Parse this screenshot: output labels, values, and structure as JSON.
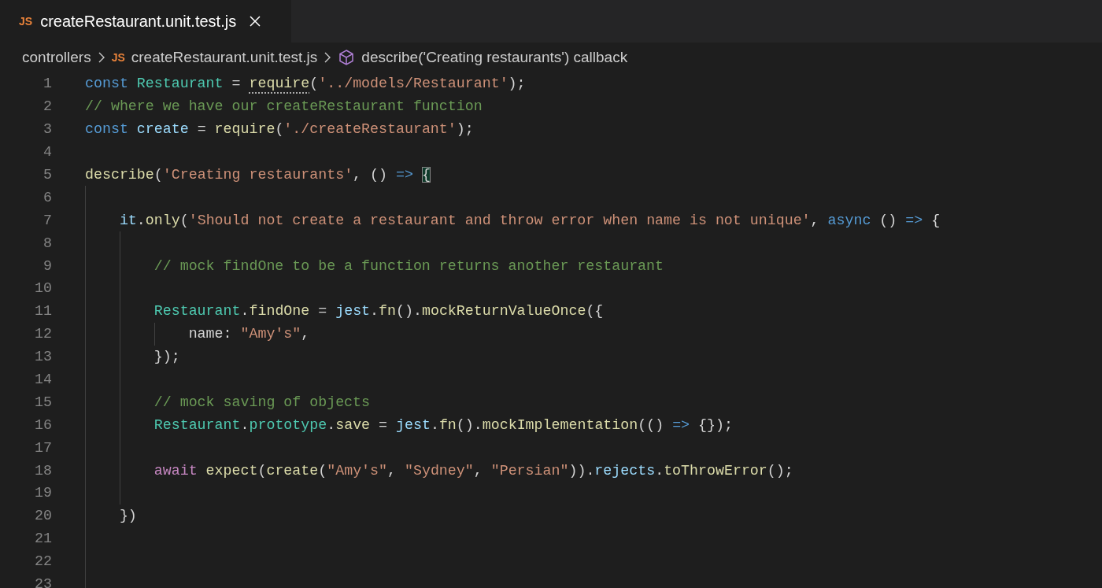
{
  "tabs": [
    {
      "label": "createRestaurant.unit.test.js",
      "badge": "JS",
      "selected": true
    }
  ],
  "breadcrumbs": [
    {
      "kind": "folder",
      "label": "controllers"
    },
    {
      "kind": "file",
      "badge": "JS",
      "label": "createRestaurant.unit.test.js"
    },
    {
      "kind": "symbol",
      "label": "describe('Creating restaurants') callback"
    }
  ],
  "lines": [
    {
      "number": "1",
      "tokens": [
        {
          "kind": "kw",
          "text": "const "
        },
        {
          "kind": "cls",
          "text": "Restaurant"
        },
        {
          "kind": "p",
          "text": " = "
        },
        {
          "kind": "hint",
          "text": "require"
        },
        {
          "kind": "p",
          "text": "("
        },
        {
          "kind": "str",
          "text": "'../models/Restaurant'"
        },
        {
          "kind": "p",
          "text": ");"
        }
      ]
    },
    {
      "number": "2",
      "tokens": [
        {
          "kind": "com",
          "text": "// where we have our createRestaurant function"
        }
      ]
    },
    {
      "number": "3",
      "tokens": [
        {
          "kind": "kw",
          "text": "const "
        },
        {
          "kind": "var",
          "text": "create"
        },
        {
          "kind": "p",
          "text": " = "
        },
        {
          "kind": "fn",
          "text": "require"
        },
        {
          "kind": "p",
          "text": "("
        },
        {
          "kind": "str",
          "text": "'./createRestaurant'"
        },
        {
          "kind": "p",
          "text": ");"
        }
      ]
    },
    {
      "number": "4"
    },
    {
      "number": "5",
      "tokens": [
        {
          "kind": "fn",
          "text": "describe"
        },
        {
          "kind": "p",
          "text": "("
        },
        {
          "kind": "str",
          "text": "'Creating restaurants'"
        },
        {
          "kind": "p",
          "text": ", () "
        },
        {
          "kind": "kw",
          "text": "=> "
        },
        {
          "kind": "match",
          "text": "{"
        }
      ]
    },
    {
      "number": "6"
    },
    {
      "number": "7",
      "tokens": [
        {
          "kind": "var",
          "text": "    it"
        },
        {
          "kind": "p",
          "text": "."
        },
        {
          "kind": "fn",
          "text": "only"
        },
        {
          "kind": "p",
          "text": "("
        },
        {
          "kind": "str",
          "text": "'Should not create a restaurant and throw error when name is not unique'"
        },
        {
          "kind": "p",
          "text": ", "
        },
        {
          "kind": "kw",
          "text": "async"
        },
        {
          "kind": "p",
          "text": " () "
        },
        {
          "kind": "kw",
          "text": "=>"
        },
        {
          "kind": "p",
          "text": " {"
        }
      ]
    },
    {
      "number": "8"
    },
    {
      "number": "9",
      "tokens": [
        {
          "kind": "com",
          "text": "        // mock findOne to be a function returns another restaurant"
        }
      ]
    },
    {
      "number": "10"
    },
    {
      "number": "11",
      "tokens": [
        {
          "kind": "cls",
          "text": "        Restaurant"
        },
        {
          "kind": "p",
          "text": "."
        },
        {
          "kind": "fn",
          "text": "findOne"
        },
        {
          "kind": "p",
          "text": " = "
        },
        {
          "kind": "var",
          "text": "jest"
        },
        {
          "kind": "p",
          "text": "."
        },
        {
          "kind": "fn",
          "text": "fn"
        },
        {
          "kind": "p",
          "text": "()."
        },
        {
          "kind": "fn",
          "text": "mockReturnValueOnce"
        },
        {
          "kind": "p",
          "text": "({"
        }
      ]
    },
    {
      "number": "12",
      "tokens": [
        {
          "kind": "prop",
          "text": "            name"
        },
        {
          "kind": "p",
          "text": ": "
        },
        {
          "kind": "str",
          "text": "\"Amy's\""
        },
        {
          "kind": "p",
          "text": ","
        }
      ]
    },
    {
      "number": "13",
      "tokens": [
        {
          "kind": "p",
          "text": "        });"
        }
      ]
    },
    {
      "number": "14"
    },
    {
      "number": "15",
      "tokens": [
        {
          "kind": "com",
          "text": "        // mock saving of objects"
        }
      ]
    },
    {
      "number": "16",
      "tokens": [
        {
          "kind": "cls",
          "text": "        Restaurant"
        },
        {
          "kind": "p",
          "text": "."
        },
        {
          "kind": "cls",
          "text": "prototype"
        },
        {
          "kind": "p",
          "text": "."
        },
        {
          "kind": "fn",
          "text": "save"
        },
        {
          "kind": "p",
          "text": " = "
        },
        {
          "kind": "var",
          "text": "jest"
        },
        {
          "kind": "p",
          "text": "."
        },
        {
          "kind": "fn",
          "text": "fn"
        },
        {
          "kind": "p",
          "text": "()."
        },
        {
          "kind": "fn",
          "text": "mockImplementation"
        },
        {
          "kind": "p",
          "text": "(() "
        },
        {
          "kind": "kw",
          "text": "=>"
        },
        {
          "kind": "p",
          "text": " {});"
        }
      ]
    },
    {
      "number": "17"
    },
    {
      "number": "18",
      "tokens": [
        {
          "kind": "ctl",
          "text": "        await "
        },
        {
          "kind": "fn",
          "text": "expect"
        },
        {
          "kind": "p",
          "text": "("
        },
        {
          "kind": "fn",
          "text": "create"
        },
        {
          "kind": "p",
          "text": "("
        },
        {
          "kind": "str",
          "text": "\"Amy's\""
        },
        {
          "kind": "p",
          "text": ", "
        },
        {
          "kind": "str",
          "text": "\"Sydney\""
        },
        {
          "kind": "p",
          "text": ", "
        },
        {
          "kind": "str",
          "text": "\"Persian\""
        },
        {
          "kind": "p",
          "text": "))."
        },
        {
          "kind": "var",
          "text": "rejects"
        },
        {
          "kind": "p",
          "text": "."
        },
        {
          "kind": "fn",
          "text": "toThrowError"
        },
        {
          "kind": "p",
          "text": "();"
        }
      ]
    },
    {
      "number": "19"
    },
    {
      "number": "20",
      "tokens": [
        {
          "kind": "p",
          "text": "    })"
        }
      ]
    },
    {
      "number": "21"
    },
    {
      "number": "22"
    },
    {
      "number": "23"
    }
  ]
}
